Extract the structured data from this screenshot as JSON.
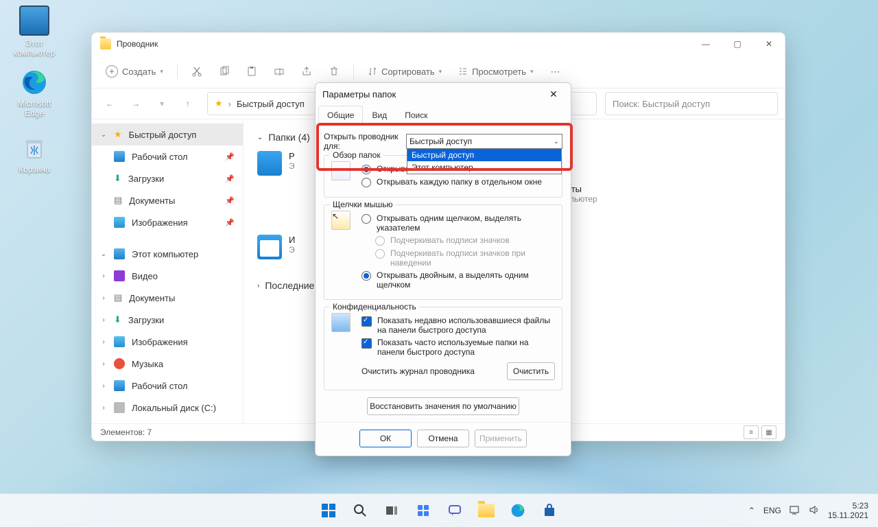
{
  "desktop_icons": [
    {
      "label": "Этот\nкомпьютер"
    },
    {
      "label": "Microsoft\nEdge"
    },
    {
      "label": "Корзина"
    }
  ],
  "window": {
    "title": "Проводник",
    "toolbar": {
      "create": "Создать",
      "sort": "Сортировать",
      "view": "Просмотреть"
    },
    "breadcrumb": "Быстрый доступ",
    "search_placeholder": "Поиск: Быстрый доступ",
    "sections": {
      "folders": "Папки (4)",
      "recent": "Последние"
    },
    "sidebar": {
      "quick": "Быстрый доступ",
      "desktop": "Рабочий стол",
      "downloads": "Загрузки",
      "documents": "Документы",
      "pictures": "Изображения",
      "thispc": "Этот компьютер",
      "video": "Видео",
      "documents2": "Документы",
      "downloads2": "Загрузки",
      "pictures2": "Изображения",
      "music": "Музыка",
      "desktop2": "Рабочий стол",
      "cdrive": "Локальный диск (C:)"
    },
    "doc_item": {
      "title": "Документы",
      "sub": "Этот компьютер"
    },
    "status": "Элементов: 7"
  },
  "dialog": {
    "title": "Параметры папок",
    "tabs": {
      "general": "Общие",
      "view": "Вид",
      "search": "Поиск"
    },
    "open_explorer_label": "Открыть проводник для:",
    "combo_value": "Быстрый доступ",
    "combo_options": [
      "Быстрый доступ",
      "Этот компьютер"
    ],
    "browse_group": "Обзор папок",
    "browse_same": "Открывать папки в одном и том же окне",
    "browse_new": "Открывать каждую папку в отдельном окне",
    "click_group": "Щелчки мышью",
    "click_single": "Открывать одним щелчком, выделять указателем",
    "click_underline_always": "Подчеркивать подписи значков",
    "click_underline_hover": "Подчеркивать подписи значков при наведении",
    "click_double": "Открывать двойным, а выделять одним щелчком",
    "privacy_group": "Конфиденциальность",
    "privacy_files": "Показать недавно использовавшиеся файлы на панели быстрого доступа",
    "privacy_folders": "Показать часто используемые папки на панели быстрого доступа",
    "clear_label": "Очистить журнал проводника",
    "clear_btn": "Очистить",
    "restore": "Восстановить значения по умолчанию",
    "ok": "ОК",
    "cancel": "Отмена",
    "apply": "Применить"
  },
  "taskbar": {
    "lang": "ENG",
    "time": "5:23",
    "date": "15.11.2021"
  }
}
